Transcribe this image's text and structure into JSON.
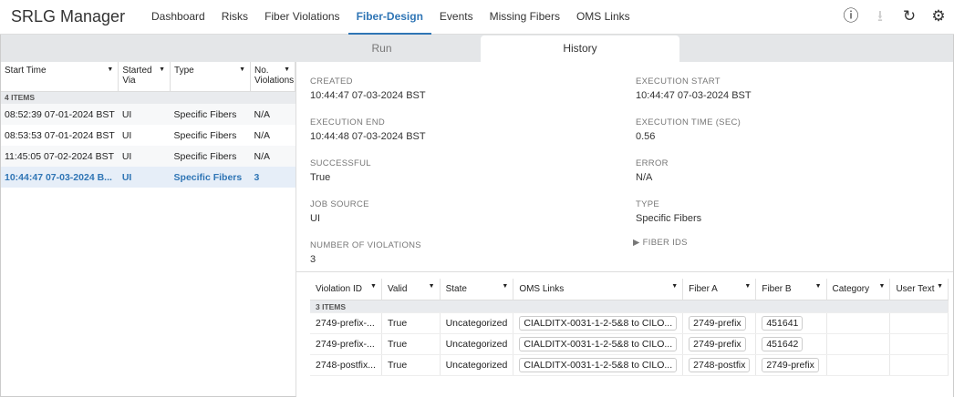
{
  "app": {
    "title": "SRLG Manager"
  },
  "nav": [
    "Dashboard",
    "Risks",
    "Fiber Violations",
    "Fiber-Design",
    "Events",
    "Missing Fibers",
    "OMS Links"
  ],
  "icons": [
    "help-icon",
    "download-icon",
    "refresh-icon",
    "settings-icon"
  ],
  "tabs": {
    "run": "Run",
    "history": "History"
  },
  "history": {
    "columns": [
      "Start Time",
      "Started Via",
      "Type",
      "No. Violations"
    ],
    "group": "4 ITEMS",
    "rows": [
      [
        "08:52:39 07-01-2024 BST",
        "UI",
        "Specific Fibers",
        "N/A"
      ],
      [
        "08:53:53 07-01-2024 BST",
        "UI",
        "Specific Fibers",
        "N/A"
      ],
      [
        "11:45:05 07-02-2024 BST",
        "UI",
        "Specific Fibers",
        "N/A"
      ],
      [
        "10:44:47 07-03-2024 B...",
        "UI",
        "Specific Fibers",
        "3"
      ]
    ]
  },
  "details": {
    "created": {
      "label": "CREATED",
      "value": "10:44:47 07-03-2024 BST"
    },
    "exec_start": {
      "label": "EXECUTION START",
      "value": "10:44:47 07-03-2024 BST"
    },
    "exec_end": {
      "label": "EXECUTION END",
      "value": "10:44:48 07-03-2024 BST"
    },
    "exec_time": {
      "label": "EXECUTION TIME (SEC)",
      "value": "0.56"
    },
    "successful": {
      "label": "SUCCESSFUL",
      "value": "True"
    },
    "error": {
      "label": "ERROR",
      "value": "N/A"
    },
    "job_source": {
      "label": "JOB SOURCE",
      "value": "UI"
    },
    "type": {
      "label": "TYPE",
      "value": "Specific Fibers"
    },
    "num_violations": {
      "label": "NUMBER OF VIOLATIONS",
      "value": "3"
    },
    "fiber_ids": "FIBER IDS"
  },
  "violations": {
    "columns": [
      "Violation ID",
      "Valid",
      "State",
      "OMS Links",
      "Fiber A",
      "Fiber B",
      "Category",
      "User Text"
    ],
    "group": "3 ITEMS",
    "rows": [
      [
        "2749-prefix-...",
        "True",
        "Uncategorized",
        "CIALDITX-0031-1-2-5&8 to CILO...",
        "2749-prefix",
        "451641",
        "",
        ""
      ],
      [
        "2749-prefix-...",
        "True",
        "Uncategorized",
        "CIALDITX-0031-1-2-5&8 to CILO...",
        "2749-prefix",
        "451642",
        "",
        ""
      ],
      [
        "2748-postfix...",
        "True",
        "Uncategorized",
        "CIALDITX-0031-1-2-5&8 to CILO...",
        "2748-postfix",
        "2749-prefix",
        "",
        ""
      ]
    ]
  }
}
